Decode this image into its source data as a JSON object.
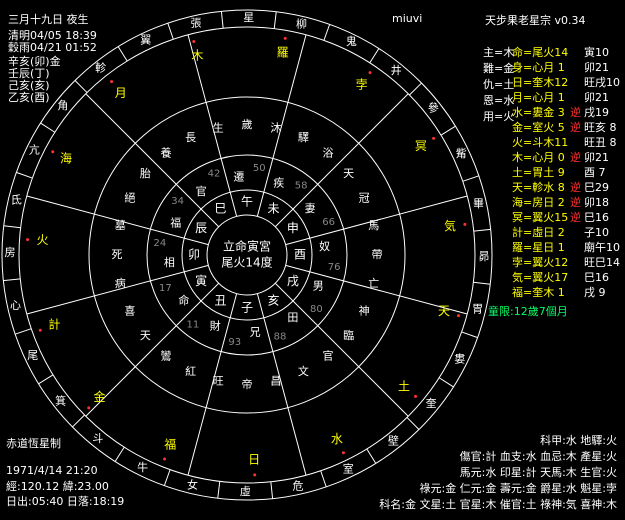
{
  "header": {
    "date_line": "三月十九日 夜生",
    "qingming": "清明04/05 18:39",
    "guyu": "穀雨04/21 01:52",
    "pillars": [
      "辛亥(卯)金",
      "壬辰(丁)",
      "己亥(亥)",
      "乙亥(酉)"
    ]
  },
  "top_center_label": "miuvi",
  "app_title": "天步果老星宗 v0.34",
  "left_summary": [
    {
      "k": "主",
      "v": "=木"
    },
    {
      "k": "難",
      "v": "=金"
    },
    {
      "k": "仇",
      "v": "=土"
    },
    {
      "k": "恩",
      "v": "=水"
    },
    {
      "k": "用",
      "v": "=火"
    }
  ],
  "planet_table": [
    {
      "name": "命=尾火14",
      "pos": "寅10",
      "mark": "",
      "color": "#ffff00"
    },
    {
      "name": "身=心月 1",
      "pos": "卯21",
      "mark": "",
      "color": "#ffff00"
    },
    {
      "name": "日=奎木12",
      "pos": "旺戌10",
      "mark": "",
      "color": "#ffff00"
    },
    {
      "name": "月=心月 1",
      "pos": "卯21",
      "mark": "",
      "color": "#ffff00"
    },
    {
      "name": "水=婁金 3",
      "pos": "戌19",
      "mark": "逆",
      "color": "#ffff00"
    },
    {
      "name": "金=室火 5",
      "pos": "旺亥 8",
      "mark": "逆",
      "color": "#ffff00"
    },
    {
      "name": "火=斗木11",
      "pos": "旺丑 8",
      "mark": "",
      "color": "#ffff00"
    },
    {
      "name": "木=心月 0",
      "pos": "卯21",
      "mark": "逆",
      "color": "#ffff00"
    },
    {
      "name": "土=胃土 9",
      "pos": "酉 7",
      "mark": "",
      "color": "#ffff00"
    },
    {
      "name": "天=軫水 8",
      "pos": "巳29",
      "mark": "逆",
      "color": "#ffff00"
    },
    {
      "name": "海=房日 2",
      "pos": "卯18",
      "mark": "逆",
      "color": "#ffff00"
    },
    {
      "name": "冥=翼火15",
      "pos": "巳16",
      "mark": "逆",
      "color": "#ffff00"
    },
    {
      "name": "計=虛日 2",
      "pos": "子10",
      "mark": "",
      "color": "#ffff00"
    },
    {
      "name": "羅=星日 1",
      "pos": "廟午10",
      "mark": "",
      "color": "#ffff00"
    },
    {
      "name": "孛=翼火12",
      "pos": "旺巳14",
      "mark": "",
      "color": "#ffff00"
    },
    {
      "name": "気=翼火17",
      "pos": "巳16",
      "mark": "",
      "color": "#ffff00"
    },
    {
      "name": "福=奎木 1",
      "pos": "戌 9",
      "mark": "",
      "color": "#ffff00"
    }
  ],
  "tonggen": "童限:12歲7個月",
  "bottom_left": {
    "credit": "赤道恆星制",
    "birth": "1971/4/14 21:20",
    "coords": "經:120.12 緯:23.00",
    "sun": "日出:05:40 日落:18:19"
  },
  "bottom_right_rows": [
    "科甲:水 地驛:火",
    "傷官:計 血支:水 血忌:木 產星:火",
    "馬元:水 印星:計 天馬:木 生官:火",
    "祿元:金 仁元:金 壽元:金 爵星:水 魁星:孛",
    "科名:金 文星:土 官星:木 催官:土 祿神:気 喜神:木"
  ],
  "center": {
    "line1": "立命寅宮",
    "line2": "尾火14度"
  },
  "inner_branches": [
    "午",
    "未",
    "申",
    "酉",
    "戌",
    "亥",
    "子",
    "丑",
    "寅",
    "卯",
    "辰",
    "巳"
  ],
  "palace_names": [
    "遷",
    "疾",
    "妻",
    "奴",
    "男",
    "田",
    "兄",
    "財",
    "命",
    "相",
    "福",
    "官"
  ],
  "palace_ages": [
    "50",
    "58",
    "66",
    "76",
    "80",
    "88",
    "93",
    "11",
    "17",
    "24",
    "34",
    "42"
  ],
  "mansions": [
    "星",
    "柳",
    "鬼",
    "井",
    "參",
    "觜",
    "畢",
    "昴",
    "胃",
    "婁",
    "奎",
    "壁",
    "室",
    "危",
    "虛",
    "女",
    "牛",
    "斗",
    "箕",
    "尾",
    "心",
    "房",
    "氐",
    "亢",
    "角",
    "軫",
    "翼",
    "張"
  ],
  "outer_planets": [
    {
      "label": "羅",
      "color": "#ffff00"
    },
    {
      "label": "孛",
      "color": "#ffff00"
    },
    {
      "label": "冥",
      "color": "#ffff00"
    },
    {
      "label": "気",
      "color": "#ffff00"
    },
    {
      "label": "天",
      "color": "#ffff00"
    },
    {
      "label": "土",
      "color": "#ffff00"
    },
    {
      "label": "水",
      "color": "#ffff00"
    },
    {
      "label": "日",
      "color": "#ffff00"
    },
    {
      "label": "福",
      "color": "#ffff00"
    },
    {
      "label": "金",
      "color": "#ffff00"
    },
    {
      "label": "計",
      "color": "#ffff00"
    },
    {
      "label": "火",
      "color": "#ffff00"
    },
    {
      "label": "海",
      "color": "#ffff00"
    },
    {
      "label": "月",
      "color": "#ffff00"
    },
    {
      "label": "木",
      "color": "#ffff00"
    }
  ],
  "stars_text": [
    "歲",
    "沐",
    "驛",
    "浴",
    "天",
    "冠",
    "馬",
    "帶",
    "亡",
    "神",
    "臨",
    "官",
    "文",
    "昌",
    "帝",
    "旺",
    "紅",
    "鸞",
    "天",
    "喜",
    "病",
    "死",
    "墓",
    "絕",
    "胎",
    "養",
    "長",
    "生"
  ],
  "colors": {
    "line": "#ffffff",
    "accent_yellow": "#ffff00",
    "accent_red": "#ff3030"
  }
}
